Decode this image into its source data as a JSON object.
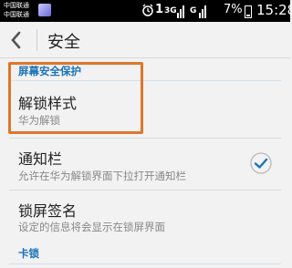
{
  "status_bar": {
    "carrier_1": "中国联通",
    "carrier_2": "中国联通",
    "network_label": "3G",
    "sim_label": "1",
    "battery_percent": "7%",
    "time": "15:28"
  },
  "header": {
    "title": "安全"
  },
  "sections": [
    {
      "header": "屏幕安全保护",
      "items": [
        {
          "title": "解锁样式",
          "subtitle": "华为解锁"
        },
        {
          "title": "通知栏",
          "subtitle": "允许在华为解锁界面下拉打开通知栏",
          "checked": true
        },
        {
          "title": "锁屏签名",
          "subtitle": "设定的信息将会显示在锁屏界面"
        }
      ]
    },
    {
      "header": "卡锁",
      "items": []
    }
  ],
  "colors": {
    "accent": "#1a73b8",
    "highlight_box": "#e0762a",
    "background": "#f2f2f2"
  },
  "icons": {
    "back": "chevron-left-icon",
    "check": "checkmark-icon",
    "alarm": "alarm-icon"
  }
}
